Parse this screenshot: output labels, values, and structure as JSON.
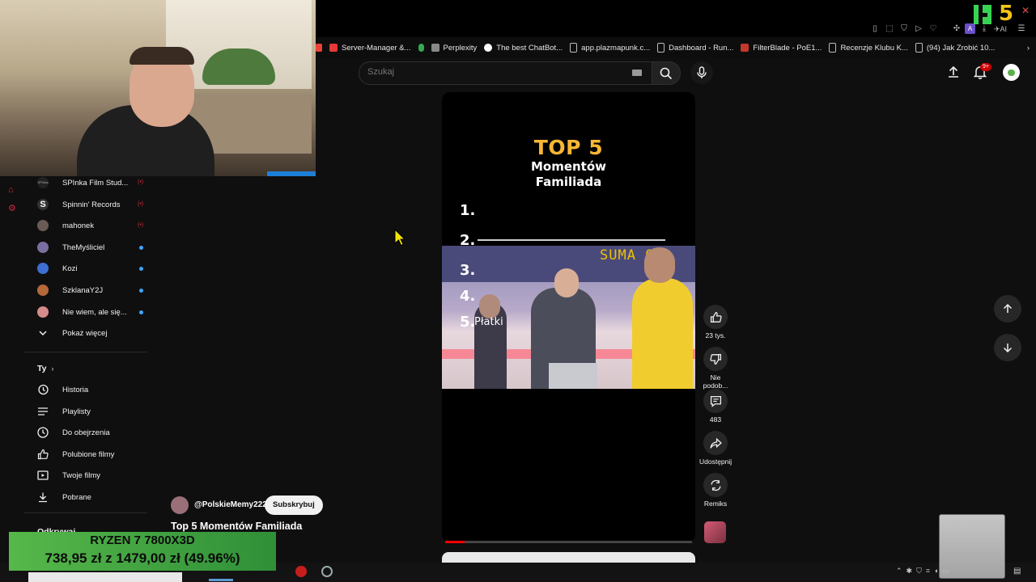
{
  "search": {
    "placeholder": "Szukaj"
  },
  "bookmarks": [
    {
      "label": "Server-Manager &...",
      "color": "#e53935"
    },
    {
      "label": "Perplexity",
      "color": "#888888"
    },
    {
      "label": "The best ChatBot...",
      "color": "#ffffff"
    },
    {
      "label": "app.plazmapunk.c...",
      "color": "#bbbbbb"
    },
    {
      "label": "Dashboard - Run...",
      "color": "#bbbbbb"
    },
    {
      "label": "FilterBlade - PoE1...",
      "color": "#c0392b"
    },
    {
      "label": "Recenzje Klubu K...",
      "color": "#bbbbbb"
    },
    {
      "label": "(94) Jak Zrobić 10...",
      "color": "#bbbbbb"
    }
  ],
  "notifications": {
    "badge": "9+"
  },
  "sidebar": {
    "subscriptions": [
      {
        "label": "SPInka Film Stud...",
        "avatar_color": "#222222",
        "status": "live"
      },
      {
        "label": "Spinnin' Records",
        "avatar_color": "#333333",
        "status": "live"
      },
      {
        "label": "mahonek",
        "avatar_color": "#6b5a55",
        "status": "live"
      },
      {
        "label": "TheMyśliciel",
        "avatar_color": "#7a6fa0",
        "status": "new"
      },
      {
        "label": "Kozi",
        "avatar_color": "#3d6fd1",
        "status": "new"
      },
      {
        "label": "SzklanaY2J",
        "avatar_color": "#b5683a",
        "status": "new"
      },
      {
        "label": "Nie wiem, ale się...",
        "avatar_color": "#d48b8b",
        "status": "new"
      }
    ],
    "show_more": "Pokaż więcej",
    "you_header": "Ty",
    "you_items": [
      {
        "label": "Historia",
        "icon": "history-icon"
      },
      {
        "label": "Playlisty",
        "icon": "playlists-icon"
      },
      {
        "label": "Do obejrzenia",
        "icon": "watch-later-icon"
      },
      {
        "label": "Polubione filmy",
        "icon": "liked-icon"
      },
      {
        "label": "Twoje filmy",
        "icon": "your-videos-icon"
      },
      {
        "label": "Pobrane",
        "icon": "downloads-icon"
      }
    ],
    "explore_header": "Odkrywaj"
  },
  "short": {
    "title_top": "TOP 5",
    "title_line2": "Momentów",
    "title_line3": "Familiada",
    "ranks": [
      "1.",
      "2.",
      "3.",
      "4.",
      "5."
    ],
    "rank5_text": "Płatki",
    "board_text": "SUMA   0",
    "progress": 0.08,
    "channel": "@PolskieMemy222",
    "subscribe": "Subskrybuj",
    "video_title": "Top 5 Momentów Familiada"
  },
  "actions": {
    "likes": "23 tys.",
    "dislike": "Nie podob...",
    "comments": "483",
    "share": "Udostępnij",
    "remix": "Remiks"
  },
  "overlay": {
    "product": "RYZEN 7 7800X3D",
    "price": "738,95 zł z 1479,00 zł (49.96%)"
  },
  "colors": {
    "accent_red": "#ff0000",
    "brand_green": "#39d353",
    "live_blue": "#3ea6ff"
  }
}
